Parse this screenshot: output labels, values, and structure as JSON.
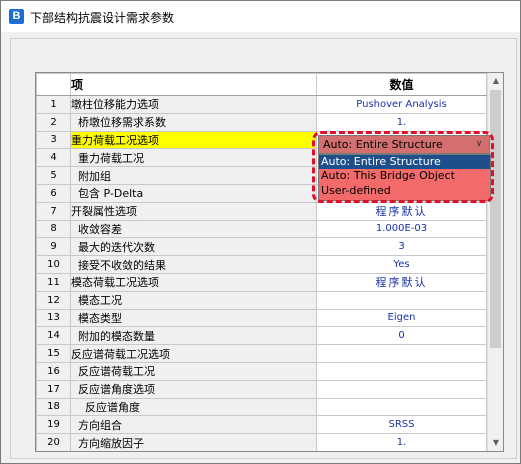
{
  "window": {
    "icon_letter": "B",
    "title": "下部结构抗震设计需求参数"
  },
  "grid": {
    "headers": {
      "item": "项",
      "value": "数值"
    },
    "rows": [
      {
        "no": "1",
        "name": "墩柱位移能力选项",
        "value": "Pushover Analysis"
      },
      {
        "no": "2",
        "name": "  桥墩位移需求系数",
        "value": "1."
      },
      {
        "no": "3",
        "name": "重力荷载工况选项",
        "value": ""
      },
      {
        "no": "4",
        "name": "  重力荷载工况",
        "value": ""
      },
      {
        "no": "5",
        "name": "  附加组",
        "value": ""
      },
      {
        "no": "6",
        "name": "  包含 P-Delta",
        "value": ""
      },
      {
        "no": "7",
        "name": "开裂属性选项",
        "value": "程序默认"
      },
      {
        "no": "8",
        "name": "  收敛容差",
        "value": "1.000E-03"
      },
      {
        "no": "9",
        "name": "  最大的迭代次数",
        "value": "3"
      },
      {
        "no": "10",
        "name": "  接受不收敛的结果",
        "value": "Yes"
      },
      {
        "no": "11",
        "name": "模态荷载工况选项",
        "value": "程序默认"
      },
      {
        "no": "12",
        "name": "  模态工况",
        "value": ""
      },
      {
        "no": "13",
        "name": "  模态类型",
        "value": "Eigen"
      },
      {
        "no": "14",
        "name": "  附加的模态数量",
        "value": "0"
      },
      {
        "no": "15",
        "name": "反应谱荷载工况选项",
        "value": ""
      },
      {
        "no": "16",
        "name": "  反应谱荷载工况",
        "value": ""
      },
      {
        "no": "17",
        "name": "  反应谱角度选项",
        "value": ""
      },
      {
        "no": "18",
        "name": "    反应谱角度",
        "value": ""
      },
      {
        "no": "19",
        "name": "  方向组合",
        "value": "SRSS"
      },
      {
        "no": "20",
        "name": "  方向缩放因子",
        "value": "1."
      }
    ],
    "selected_row": "3"
  },
  "dropdown": {
    "current": "Auto: Entire Structure",
    "options": [
      "Auto: Entire Structure",
      "Auto: This Bridge Object",
      "User-defined"
    ],
    "highlighted_index": 0
  },
  "colors": {
    "selected_row": "#ffff00",
    "dropdown_list": "#f26a6a",
    "highlight_ring": "#e0102a",
    "value_text": "#1a32a8"
  },
  "icons": {
    "scroll_up": "triangle-up-icon",
    "scroll_down": "triangle-down-icon",
    "dropdown": "chevron-down-icon"
  }
}
